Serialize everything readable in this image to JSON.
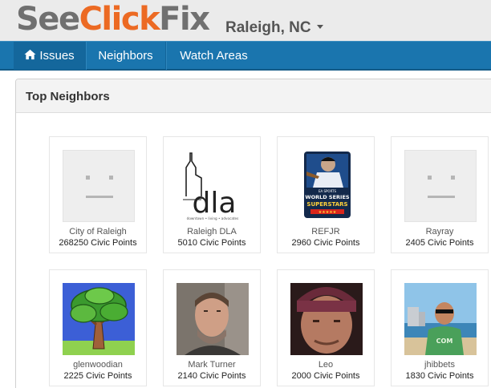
{
  "header": {
    "logo": {
      "part1": "See",
      "part2": "Click",
      "part3": "Fix"
    },
    "city": "Raleigh, NC"
  },
  "nav": {
    "items": [
      {
        "label": "Issues",
        "icon": "home-icon"
      },
      {
        "label": "Neighbors"
      },
      {
        "label": "Watch Areas"
      }
    ]
  },
  "panel": {
    "title": "Top Neighbors"
  },
  "neighbors": [
    {
      "name": "City of Raleigh",
      "points": "268250 Civic Points",
      "avatar": "placeholder-face"
    },
    {
      "name": "Raleigh DLA",
      "points": "5010 Civic Points",
      "avatar": "dla-logo",
      "logo_text": "dla",
      "logo_tagline": "downtown • living • advocates"
    },
    {
      "name": "REFJR",
      "points": "2960 Civic Points",
      "avatar": "world-series-superstars-game-cover",
      "cover_top": "EA SPORTS",
      "cover_title1": "WORLD SERIES",
      "cover_title2": "SUPERSTARS"
    },
    {
      "name": "Rayray",
      "points": "2405 Civic Points",
      "avatar": "placeholder-face"
    },
    {
      "name": "glenwoodian",
      "points": "2225 Civic Points",
      "avatar": "tree-drawing"
    },
    {
      "name": "Mark Turner",
      "points": "2140 Civic Points",
      "avatar": "man-photo"
    },
    {
      "name": "Leo",
      "points": "2000 Civic Points",
      "avatar": "man-beanie-photo"
    },
    {
      "name": "jhibbets",
      "points": "1830 Civic Points",
      "avatar": "beach-photo",
      "shirt_text": "COM"
    }
  ],
  "colors": {
    "nav_blue": "#1a75ae",
    "logo_orange": "#ec6a23",
    "logo_gray": "#707070"
  }
}
